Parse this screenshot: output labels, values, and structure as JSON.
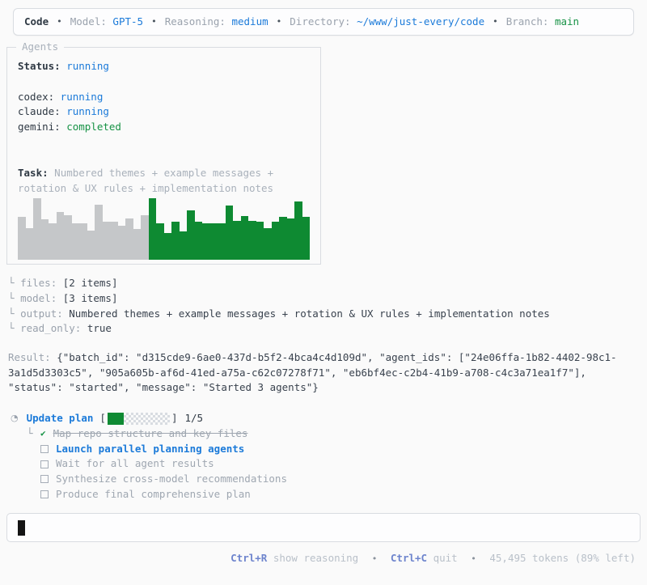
{
  "topbar": {
    "app": "Code",
    "separator": "•",
    "model_label": "Model:",
    "model": "GPT-5",
    "reasoning_label": "Reasoning:",
    "reasoning": "medium",
    "directory_label": "Directory:",
    "directory": "~/www/just-every/code",
    "branch_label": "Branch:",
    "branch": "main"
  },
  "agents": {
    "panel_title": "Agents",
    "status_label": "Status:",
    "status": "running",
    "status_color": "#1b7ad9",
    "list": [
      {
        "name": "codex",
        "status": "running",
        "status_color": "#1b7ad9"
      },
      {
        "name": "claude",
        "status": "running",
        "status_color": "#1b7ad9"
      },
      {
        "name": "gemini",
        "status": "completed",
        "status_color": "#169245"
      }
    ],
    "task_label": "Task:",
    "task": "Numbered themes + example messages + rotation & UX rules + implementation notes",
    "activity": {
      "type": "bar",
      "gray_color": "#c5c7c9",
      "green_color": "#0e8a32",
      "gray_heights": [
        70,
        52,
        100,
        66,
        60,
        78,
        73,
        60,
        60,
        48,
        90,
        62,
        62,
        55,
        68,
        50,
        73
      ],
      "green_heights": [
        100,
        60,
        44,
        62,
        46,
        80,
        62,
        60,
        60,
        60,
        88,
        64,
        72,
        64,
        62,
        52,
        62,
        70,
        68,
        95,
        70
      ]
    }
  },
  "params": {
    "branch_glyph": "└",
    "items": [
      {
        "key": "files:",
        "value": "[2 items]"
      },
      {
        "key": "model:",
        "value": "[3 items]"
      },
      {
        "key": "output:",
        "value": "Numbered themes + example messages + rotation & UX rules + implementation notes"
      },
      {
        "key": "read_only:",
        "value": "true"
      }
    ]
  },
  "result": {
    "label": "Result:",
    "value": "{\"batch_id\": \"d315cde9-6ae0-437d-b5f2-4bca4c4d109d\", \"agent_ids\": [\"24e06ffa-1b82-4402-98c1-3a1d5d3303c5\", \"905a605b-af6d-41ed-a75a-c62c07278f71\", \"eb6bf4ec-c2b4-41b9-a708-c4c3a71ea1f7\"], \"status\": \"started\", \"message\": \"Started 3 agents\"}"
  },
  "plan": {
    "clock_icon": "◔",
    "title": "Update plan",
    "bracket_open": "[",
    "bracket_close": "]",
    "progress": {
      "completed": 1,
      "total": 5,
      "label": "1/5",
      "fill_color": "#0f8a33"
    },
    "branch_glyph": "└",
    "check_glyph": "✔",
    "items": [
      {
        "state": "done",
        "text": "Map repo structure and key files"
      },
      {
        "state": "active",
        "text": "Launch parallel planning agents"
      },
      {
        "state": "pending",
        "text": "Wait for all agent results"
      },
      {
        "state": "pending",
        "text": "Synthesize cross-model recommendations"
      },
      {
        "state": "pending",
        "text": "Produce final comprehensive plan"
      }
    ]
  },
  "composer": {
    "value": ""
  },
  "footer": {
    "separator": "•",
    "shortcuts": [
      {
        "key": "Ctrl+R",
        "action": "show reasoning"
      },
      {
        "key": "Ctrl+C",
        "action": "quit"
      }
    ],
    "tokens": "45,495 tokens (89% left)"
  }
}
